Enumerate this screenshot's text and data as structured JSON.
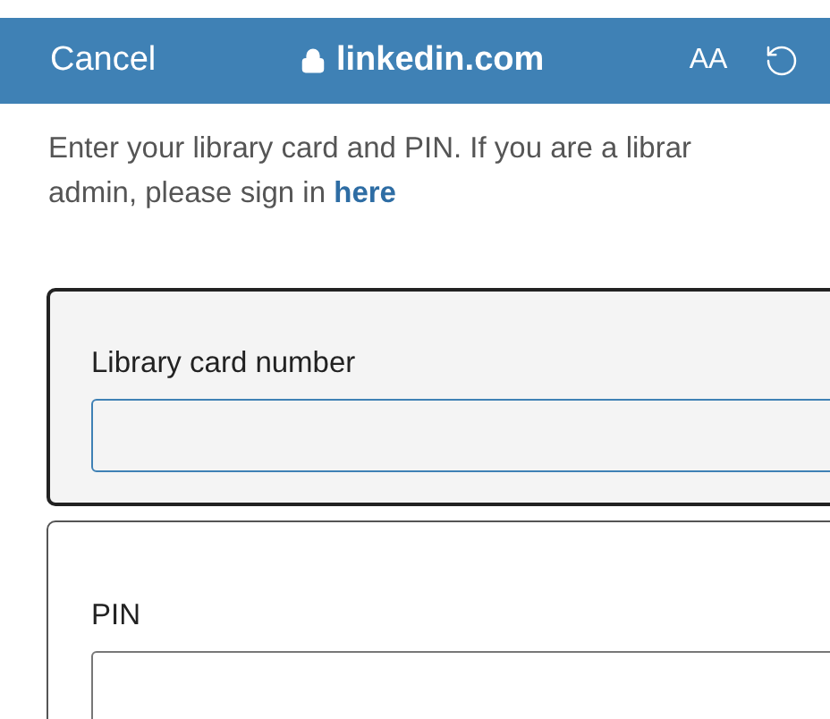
{
  "browser_bar": {
    "cancel": "Cancel",
    "address": "linkedin.com",
    "text_size": "AA"
  },
  "intro": {
    "text": "Enter your library card and PIN. If you are a librar\nadmin, please sign in",
    "link": "here"
  },
  "fields": [
    {
      "label": "Library card number",
      "focused": true
    },
    {
      "label": "PIN",
      "focused": false
    }
  ]
}
